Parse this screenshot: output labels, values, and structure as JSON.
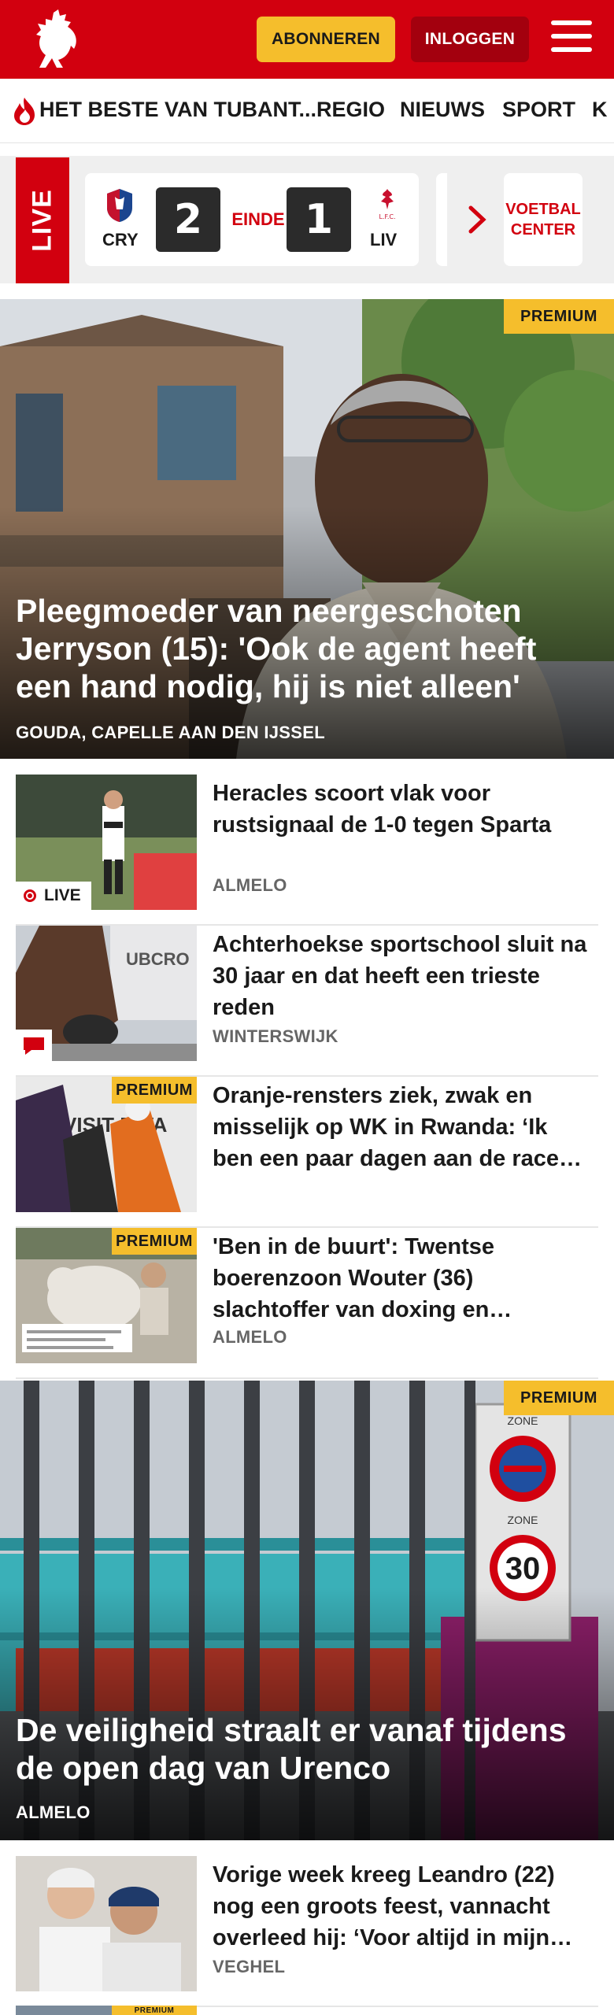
{
  "header": {
    "subscribe_label": "ABONNEREN",
    "login_label": "INLOGGEN",
    "brand_color": "#d2000f",
    "accent_color": "#f5be2c"
  },
  "nav": {
    "items": [
      "HET BESTE VAN TUBANT...",
      "REGIO",
      "NIEUWS",
      "SPORT",
      "K"
    ]
  },
  "live": {
    "tag": "LIVE",
    "home_code": "CRY",
    "away_code": "LIV",
    "home_score": "2",
    "away_score": "1",
    "status": "EINDE",
    "away_crest_text": "L.F.C.",
    "voetbal_center_line1": "VOETBAL",
    "voetbal_center_line2": "CENTER"
  },
  "hero1": {
    "badge": "PREMIUM",
    "title": "Pleegmoeder van neergeschoten Jerryson (15): 'Ook de agent heeft een hand nodig, hij is niet alleen'",
    "location": "GOUDA, CAPELLE AAN DEN IJSSEL"
  },
  "articles": [
    {
      "title": "Heracles scoort vlak voor rustsignaal de 1-0 tegen Sparta",
      "location": "ALMELO",
      "badge": "LIVE"
    },
    {
      "title": "Achterhoekse sportschool sluit na 30 jaar en dat heeft een trieste reden",
      "location": "WINTERSWIJK",
      "thumb_text": "UBCRO"
    },
    {
      "title": "Oranje-rensters ziek, zwak en misselijk op WK in Rwanda: ‘Ik ben een paar dagen aan de race voorbij’",
      "location": "",
      "badge": "PREMIUM",
      "thumb_text": "VISIT RWA"
    },
    {
      "title": "'Ben in de buurt': Twentse boerenzoon Wouter (36) slachtoffer van doxing en bedreiging",
      "location": "ALMELO",
      "badge": "PREMIUM"
    }
  ],
  "hero2": {
    "badge": "PREMIUM",
    "title": "De veiligheid straalt er vanaf tijdens de open dag van Urenco",
    "location": "ALMELO",
    "sign_zone_top": "ZONE",
    "sign_zone_mid": "ZONE",
    "sign_speed": "30"
  },
  "articles2": [
    {
      "title": "Vorige week kreeg Leandro (22) nog een groots feest, vannacht overleed hij: ‘Voor altijd in mijn hart’",
      "location": "VEGHEL"
    },
    {
      "badge": "PREMIUM"
    }
  ]
}
